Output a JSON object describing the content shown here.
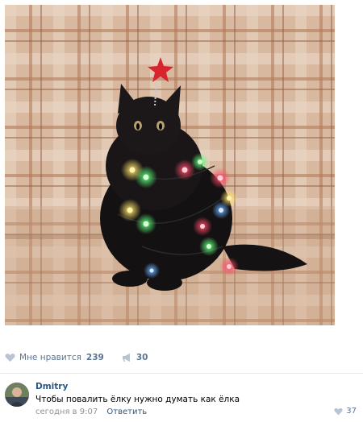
{
  "post": {
    "image_alt": "Black fluffy cat wrapped in colorful Christmas lights with a red star on its head, sitting on a plaid blanket"
  },
  "actions": {
    "like_label": "Мне нравится",
    "like_count": "239",
    "share_count": "30"
  },
  "comment": {
    "author": "Dmitry",
    "text": "Чтобы повалить ёлку нужно думать как ёлка",
    "time": "сегодня в 9:07",
    "reply_label": "Ответить",
    "like_count": "37"
  },
  "colors": {
    "link": "#2a5885",
    "icon": "#b8c4d2",
    "muted": "#939393"
  },
  "icons": [
    "heart-icon",
    "megaphone-icon",
    "user-avatar"
  ]
}
